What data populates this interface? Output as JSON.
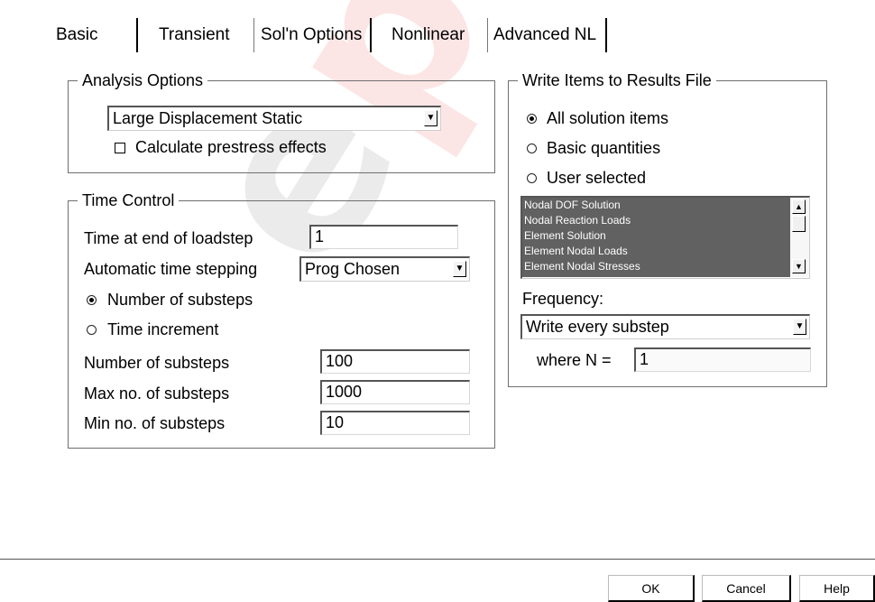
{
  "tabs": [
    "Basic",
    "Transient",
    "Sol'n Options",
    "Nonlinear",
    "Advanced NL"
  ],
  "analysis_options": {
    "title": "Analysis Options",
    "analysis_type": "Large Displacement Static",
    "prestress_label": "Calculate prestress effects",
    "prestress_checked": false
  },
  "time_control": {
    "title": "Time Control",
    "time_end_label": "Time at end of loadstep",
    "time_end_value": "1",
    "auto_step_label": "Automatic time stepping",
    "auto_step_value": "Prog Chosen",
    "radio_substeps_label": "Number of substeps",
    "radio_increment_label": "Time increment",
    "num_substeps_label": "Number of substeps",
    "num_substeps_value": "100",
    "max_substeps_label": "Max no. of substeps",
    "max_substeps_value": "1000",
    "min_substeps_label": "Min no. of substeps",
    "min_substeps_value": "10"
  },
  "results_file": {
    "title": "Write Items to Results File",
    "radio_all": "All solution items",
    "radio_basic": "Basic quantities",
    "radio_user": "User selected",
    "selected_radio": "All solution items",
    "items": [
      "Nodal DOF Solution",
      "Nodal Reaction Loads",
      "Element Solution",
      "Element Nodal Loads",
      "Element Nodal Stresses"
    ],
    "frequency_label": "Frequency:",
    "frequency_value": "Write every substep",
    "where_n_label": "where N =",
    "where_n_value": "1"
  },
  "buttons": {
    "ok": "OK",
    "cancel": "Cancel",
    "help": "Help"
  },
  "colors": {
    "list_background": "#616161",
    "watermark": "#e00000"
  }
}
